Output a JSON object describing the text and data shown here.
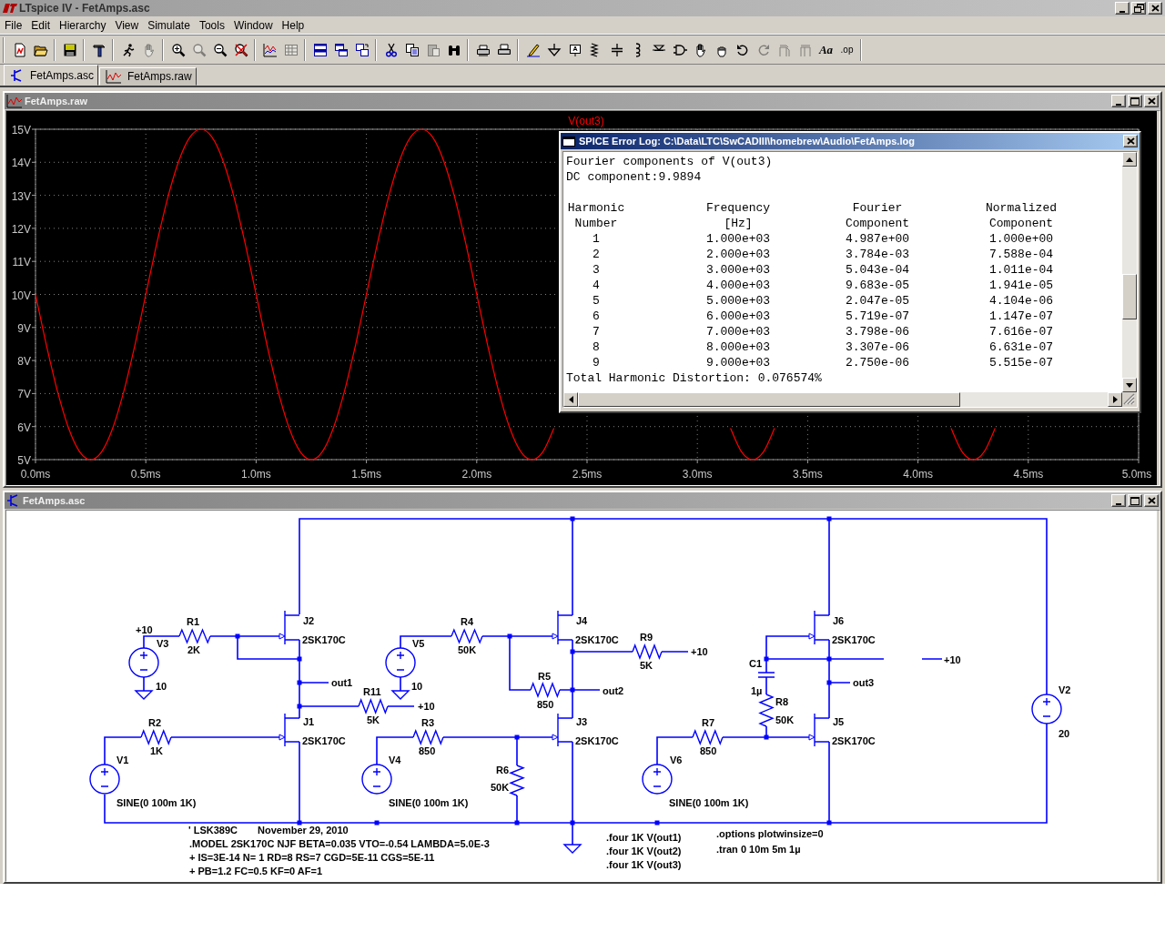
{
  "window": {
    "title": "LTspice IV - FetAmps.asc"
  },
  "menu": [
    "File",
    "Edit",
    "Hierarchy",
    "View",
    "Simulate",
    "Tools",
    "Window",
    "Help"
  ],
  "toolbar": {
    "groups": [
      [
        {
          "disabled": false
        },
        {
          "disabled": false
        }
      ],
      [
        {
          "disabled": false
        }
      ],
      [
        {
          "disabled": false
        }
      ],
      [
        {
          "disabled": false
        },
        {
          "disabled": true
        }
      ],
      [
        {
          "disabled": false
        },
        {
          "disabled": true
        },
        {
          "disabled": false
        },
        {
          "disabled": false
        }
      ],
      [
        {
          "disabled": false
        },
        {
          "disabled": true
        }
      ],
      [
        {
          "disabled": false
        },
        {
          "disabled": false
        },
        {
          "disabled": false
        }
      ],
      [
        {
          "disabled": false
        },
        {
          "disabled": false
        },
        {
          "disabled": true
        },
        {
          "disabled": false
        }
      ],
      [
        {
          "disabled": false
        },
        {
          "disabled": false
        }
      ],
      [
        {
          "disabled": false
        },
        {
          "disabled": false
        },
        {
          "disabled": false
        },
        {
          "disabled": false
        },
        {
          "disabled": false
        },
        {
          "disabled": false
        },
        {
          "disabled": false
        },
        {
          "disabled": false
        },
        {
          "disabled": false
        },
        {
          "disabled": false
        },
        {
          "disabled": false
        },
        {
          "disabled": true
        },
        {
          "disabled": true
        },
        {
          "disabled": true
        },
        {
          "disabled": false,
          "label": "Aa"
        },
        {
          "disabled": false,
          "label": ".op"
        }
      ]
    ]
  },
  "tabs": [
    {
      "label": "FetAmps.asc",
      "selected": true
    },
    {
      "label": "FetAmps.raw",
      "selected": false
    }
  ],
  "waveform_window": {
    "title": "FetAmps.raw",
    "chart_data": {
      "type": "line",
      "x": [
        0,
        0.05,
        0.1,
        0.15,
        0.2,
        0.25,
        0.3,
        0.35,
        0.4,
        0.45,
        0.5,
        0.55,
        0.6,
        0.65,
        0.7,
        0.75,
        0.8,
        0.85,
        0.9,
        0.95,
        1,
        1.05,
        1.1,
        1.15,
        1.2,
        1.25,
        1.3,
        1.35,
        1.4,
        1.45,
        1.5,
        1.55,
        1.6,
        1.65,
        1.7,
        1.75,
        1.8,
        1.85,
        1.9,
        1.95,
        2,
        2.05,
        2.1,
        2.15,
        2.2,
        2.25,
        2.3,
        2.35,
        3.15,
        3.2,
        3.25,
        3.3,
        3.35,
        4.15,
        4.2,
        4.25,
        4.3,
        4.35
      ],
      "series": [
        {
          "name": "V(out3)",
          "color": "#ff0000",
          "values": [
            10,
            8.45,
            7.06,
            5.95,
            5.24,
            5,
            5.24,
            5.95,
            7.06,
            8.45,
            10,
            11.55,
            12.94,
            14.05,
            14.76,
            15,
            14.76,
            14.05,
            12.94,
            11.55,
            10,
            8.45,
            7.06,
            5.95,
            5.24,
            5,
            5.24,
            5.95,
            7.06,
            8.45,
            10,
            11.55,
            12.94,
            14.05,
            14.76,
            15,
            14.76,
            14.05,
            12.94,
            11.55,
            10,
            8.45,
            7.06,
            5.95,
            5.24,
            5,
            5.24,
            5.95,
            5.95,
            5.24,
            5,
            5.24,
            5.95,
            5.95,
            5.24,
            5,
            5.24,
            5.95
          ]
        }
      ],
      "grid": true,
      "xlim": [
        0,
        5
      ],
      "ylim": [
        5,
        15
      ],
      "xticks": [
        {
          "value": 0,
          "label": "0.0ms"
        },
        {
          "value": 0.5,
          "label": "0.5ms"
        },
        {
          "value": 1,
          "label": "1.0ms"
        },
        {
          "value": 1.5,
          "label": "1.5ms"
        },
        {
          "value": 2,
          "label": "2.0ms"
        },
        {
          "value": 2.5,
          "label": "2.5ms"
        },
        {
          "value": 3,
          "label": "3.0ms"
        },
        {
          "value": 3.5,
          "label": "3.5ms"
        },
        {
          "value": 4,
          "label": "4.0ms"
        },
        {
          "value": 4.5,
          "label": "4.5ms"
        },
        {
          "value": 5,
          "label": "5.0ms"
        }
      ],
      "yticks": [
        {
          "value": 15,
          "label": "15V"
        },
        {
          "value": 14,
          "label": "14V"
        },
        {
          "value": 13,
          "label": "13V"
        },
        {
          "value": 12,
          "label": "12V"
        },
        {
          "value": 11,
          "label": "11V"
        },
        {
          "value": 10,
          "label": "10V"
        },
        {
          "value": 9,
          "label": "9V"
        },
        {
          "value": 8,
          "label": "8V"
        },
        {
          "value": 7,
          "label": "7V"
        },
        {
          "value": 6,
          "label": "6V"
        },
        {
          "value": 5,
          "label": "5V"
        }
      ]
    }
  },
  "log_window": {
    "title": "SPICE Error Log: C:\\Data\\LTC\\SwCADIII\\homebrew\\Audio\\FetAmps.log",
    "lines": [
      "Fourier components of V(out3)",
      "DC component:9.9894"
    ],
    "header_rows": [
      [
        "Harmonic",
        "Frequency",
        "Fourier",
        "Normalized"
      ],
      [
        "Number",
        "[Hz]",
        "Component",
        "Component"
      ]
    ],
    "rows": [
      [
        "1",
        "1.000e+03",
        "4.987e+00",
        "1.000e+00"
      ],
      [
        "2",
        "2.000e+03",
        "3.784e-03",
        "7.588e-04"
      ],
      [
        "3",
        "3.000e+03",
        "5.043e-04",
        "1.011e-04"
      ],
      [
        "4",
        "4.000e+03",
        "9.683e-05",
        "1.941e-05"
      ],
      [
        "5",
        "5.000e+03",
        "2.047e-05",
        "4.104e-06"
      ],
      [
        "6",
        "6.000e+03",
        "5.719e-07",
        "1.147e-07"
      ],
      [
        "7",
        "7.000e+03",
        "3.798e-06",
        "7.616e-07"
      ],
      [
        "8",
        "8.000e+03",
        "3.307e-06",
        "6.631e-07"
      ],
      [
        "9",
        "9.000e+03",
        "2.750e-06",
        "5.515e-07"
      ]
    ],
    "summary": "Total Harmonic Distortion: 0.076574%"
  },
  "schematic_window": {
    "title": "FetAmps.asc",
    "labels": [
      "R1",
      "J2",
      "R4",
      "J4",
      "J6",
      "+10",
      "2SK170C",
      "2SK170C",
      "R9",
      "2SK170C",
      "V3",
      "V5",
      "2K",
      "50K",
      "+10",
      "+10",
      "5K",
      "C1",
      "R5",
      "10",
      "out1",
      "10",
      "out3",
      "R11",
      "out2",
      "1µ",
      "V2",
      "R8",
      "+10",
      "850",
      "R2",
      "J1",
      "5K",
      "R3",
      "J3",
      "R7",
      "50K",
      "J5",
      "20",
      "2SK170C",
      "2SK170C",
      "2SK170C",
      "1K",
      "850",
      "850",
      "V1",
      "V4",
      "V6",
      "R6",
      "50K",
      "SINE(0 100m 1K)",
      "SINE(0 100m 1K)",
      "SINE(0 100m 1K)"
    ],
    "directives": [
      "' LSK389C",
      "November 29, 2010",
      ".MODEL 2SK170C NJF BETA=0.035 VTO=-0.54 LAMBDA=5.0E-3",
      "+ IS=3E-14 N= 1 RD=8 RS=7 CGD=5E-11 CGS=5E-11",
      "+ PB=1.2 FC=0.5 KF=0 AF=1",
      ".four 1K V(out1)",
      ".four 1K V(out2)",
      ".four 1K V(out3)",
      ".options plotwinsize=0",
      ".tran 0 10m 5m 1µ"
    ]
  }
}
